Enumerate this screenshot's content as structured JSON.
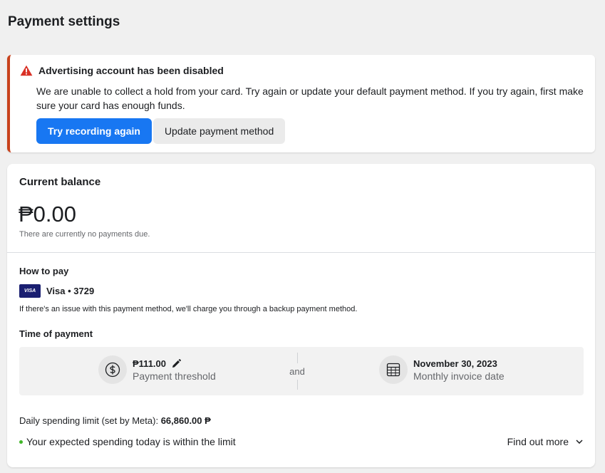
{
  "page": {
    "title": "Payment settings"
  },
  "alert": {
    "title": "Advertising account has been disabled",
    "body": "We are unable to collect a hold from your card. Try again or update your default payment method. If you try again, first make sure your card has enough funds.",
    "primary_button": "Try recording again",
    "secondary_button": "Update payment method",
    "icon": "warning-icon",
    "accent_color": "#c8421c"
  },
  "balance": {
    "heading": "Current balance",
    "amount": "₱0.00",
    "note": "There are currently no payments due."
  },
  "how_to_pay": {
    "heading": "How to pay",
    "card_logo": "VISA",
    "card_label": "Visa • 3729",
    "backup_note": "If there's an issue with this payment method, we'll charge you through a backup payment method."
  },
  "time_of_payment": {
    "heading": "Time of payment",
    "threshold": {
      "value": "₱111.00",
      "label": "Payment threshold",
      "icon": "dollar-coin-icon"
    },
    "and_text": "and",
    "invoice": {
      "value": "November 30, 2023",
      "label": "Monthly invoice date",
      "icon": "calendar-icon"
    }
  },
  "spending": {
    "limit_label": "Daily spending limit (set by Meta): ",
    "limit_value": "66,860.00 ₱",
    "status_text": "Your expected spending today is within the limit",
    "status_color": "#42b72a",
    "find_more": "Find out more"
  },
  "colors": {
    "primary": "#1877f2",
    "background": "#f0f0f0"
  }
}
